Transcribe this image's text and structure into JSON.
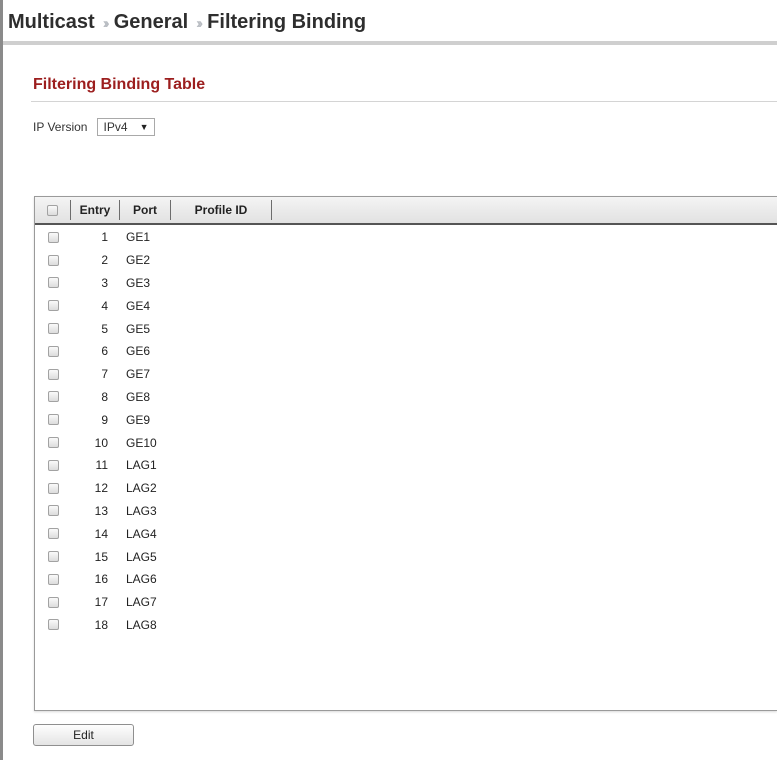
{
  "breadcrumb": [
    "Multicast",
    "General",
    "Filtering Binding"
  ],
  "breadcrumb_separator": "››",
  "section": {
    "title": "Filtering Binding Table"
  },
  "ip_version": {
    "label": "IP Version",
    "selected": "IPv4"
  },
  "table": {
    "columns": [
      "Entry",
      "Port",
      "Profile ID"
    ],
    "rows": [
      {
        "entry": "1",
        "port": "GE1",
        "profile_id": ""
      },
      {
        "entry": "2",
        "port": "GE2",
        "profile_id": ""
      },
      {
        "entry": "3",
        "port": "GE3",
        "profile_id": ""
      },
      {
        "entry": "4",
        "port": "GE4",
        "profile_id": ""
      },
      {
        "entry": "5",
        "port": "GE5",
        "profile_id": ""
      },
      {
        "entry": "6",
        "port": "GE6",
        "profile_id": ""
      },
      {
        "entry": "7",
        "port": "GE7",
        "profile_id": ""
      },
      {
        "entry": "8",
        "port": "GE8",
        "profile_id": ""
      },
      {
        "entry": "9",
        "port": "GE9",
        "profile_id": ""
      },
      {
        "entry": "10",
        "port": "GE10",
        "profile_id": ""
      },
      {
        "entry": "11",
        "port": "LAG1",
        "profile_id": ""
      },
      {
        "entry": "12",
        "port": "LAG2",
        "profile_id": ""
      },
      {
        "entry": "13",
        "port": "LAG3",
        "profile_id": ""
      },
      {
        "entry": "14",
        "port": "LAG4",
        "profile_id": ""
      },
      {
        "entry": "15",
        "port": "LAG5",
        "profile_id": ""
      },
      {
        "entry": "16",
        "port": "LAG6",
        "profile_id": ""
      },
      {
        "entry": "17",
        "port": "LAG7",
        "profile_id": ""
      },
      {
        "entry": "18",
        "port": "LAG8",
        "profile_id": ""
      }
    ]
  },
  "buttons": {
    "edit": "Edit"
  },
  "colors": {
    "section_title": "#9c1e1e",
    "breadcrumb_text": "#2e2e2e",
    "breadcrumb_separator": "#b8bcc2"
  }
}
